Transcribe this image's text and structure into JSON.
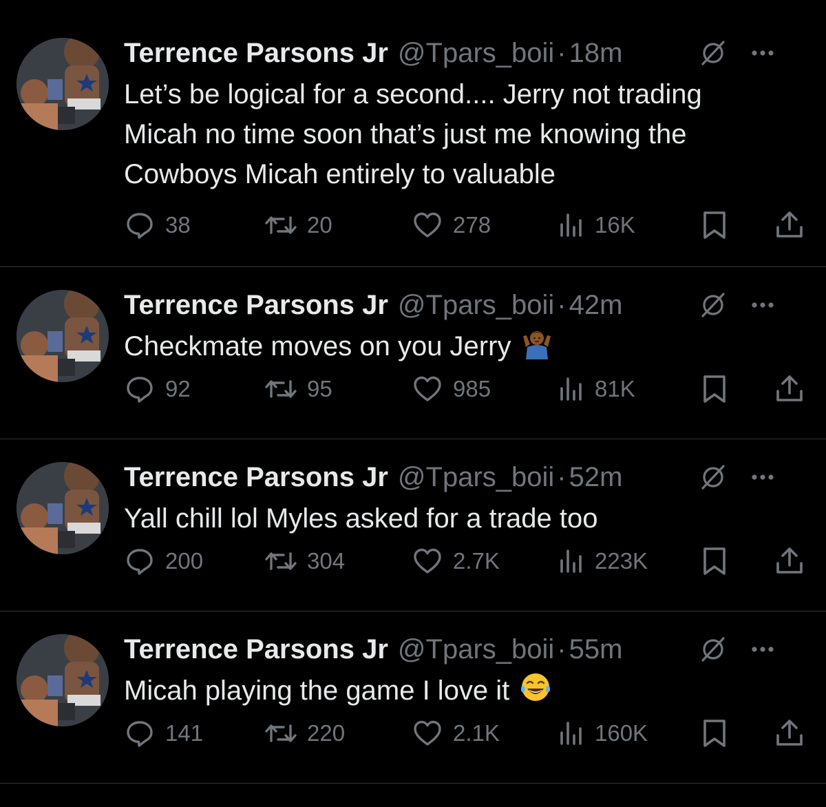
{
  "colors": {
    "background": "#000000",
    "text": "#e7e9ea",
    "secondary": "#71767b",
    "divider": "#2f3336"
  },
  "icons": {
    "reply": "reply-icon",
    "retweet": "retweet-icon",
    "like": "heart-icon",
    "views": "views-icon",
    "bookmark": "bookmark-icon",
    "share": "share-icon",
    "grok": "grok-icon",
    "more": "more-icon"
  },
  "tweets": [
    {
      "name": "Terrence Parsons Jr",
      "handle": "@Tpars_boii",
      "separator": "·",
      "time": "18m",
      "text": "Let’s be logical for a second.... Jerry not trading\nMicah no time soon that’s just me knowing the\nCowboys Micah entirely to valuable",
      "emoji": "",
      "replies": "38",
      "retweets": "20",
      "likes": "278",
      "views": "16K"
    },
    {
      "name": "Terrence Parsons Jr",
      "handle": "@Tpars_boii",
      "separator": "·",
      "time": "42m",
      "text": "Checkmate moves on you Jerry",
      "emoji": "shrug-emoji",
      "replies": "92",
      "retweets": "95",
      "likes": "985",
      "views": "81K"
    },
    {
      "name": "Terrence Parsons Jr",
      "handle": "@Tpars_boii",
      "separator": "·",
      "time": "52m",
      "text": "Yall chill lol Myles asked for a trade too",
      "emoji": "",
      "replies": "200",
      "retweets": "304",
      "likes": "2.7K",
      "views": "223K"
    },
    {
      "name": "Terrence Parsons Jr",
      "handle": "@Tpars_boii",
      "separator": "·",
      "time": "55m",
      "text": "Micah playing the game I love it",
      "emoji": "tears-of-joy-emoji",
      "replies": "141",
      "retweets": "220",
      "likes": "2.1K",
      "views": "160K"
    }
  ]
}
